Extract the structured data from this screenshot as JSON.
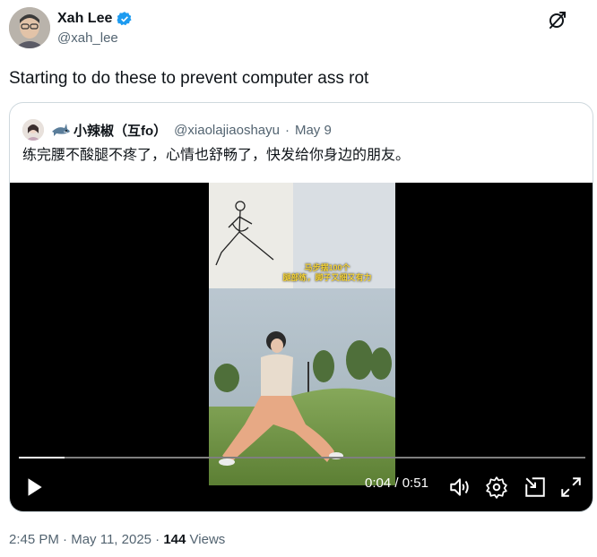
{
  "author": {
    "name": "Xah Lee",
    "handle": "@xah_lee"
  },
  "tweet": {
    "text": "Starting to do these to prevent computer ass rot"
  },
  "quote": {
    "name": "小辣椒（互fo）",
    "handle": "@xiaolajiaoshayu",
    "separator": "·",
    "date": "May 9",
    "text": "练完腰不酸腿不疼了，心情也舒畅了，快发给你身边的朋友。"
  },
  "video": {
    "elapsed": "0:04",
    "time_sep": "/",
    "duration": "0:51",
    "progress_fraction": 0.08,
    "overlay_line1": "马步摆100个",
    "overlay_line2": "腿部练，脚子又细又有力"
  },
  "footer": {
    "time": "2:45 PM",
    "sep": "·",
    "date": "May 11, 2025",
    "sep2": "·",
    "views_count": "144",
    "views_label": "Views"
  },
  "colors": {
    "verified": "#1d9bf0",
    "muted": "#536471",
    "border": "#cfd9de"
  },
  "icons": [
    "verified-badge-icon",
    "grok-icon",
    "play-icon",
    "volume-icon",
    "settings-icon",
    "dock-icon",
    "fullscreen-icon"
  ]
}
